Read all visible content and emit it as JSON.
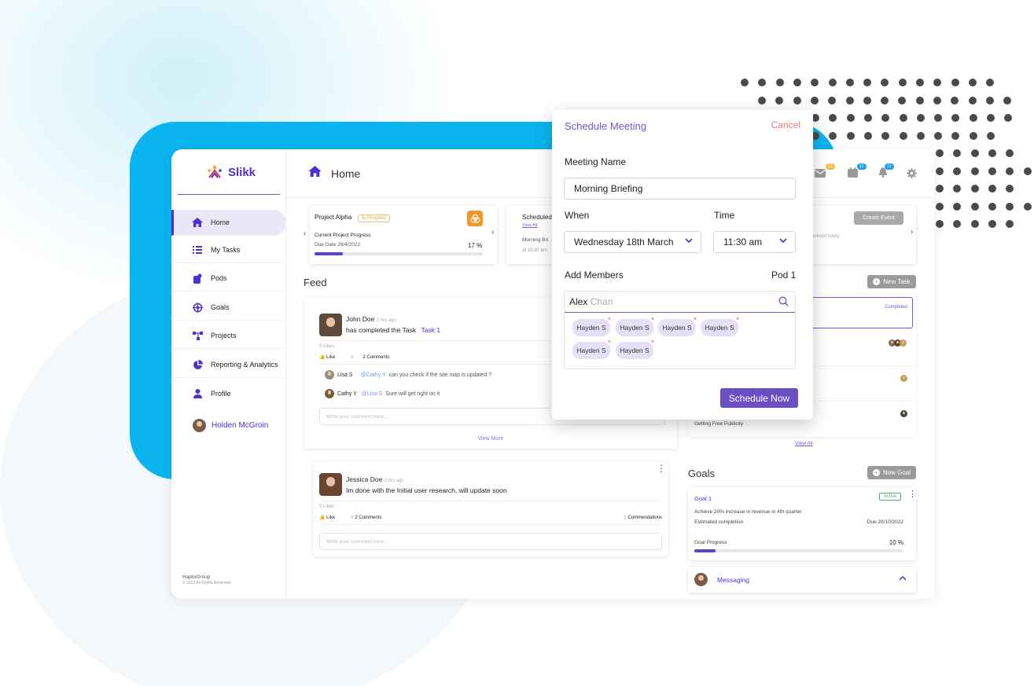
{
  "app": {
    "name": "Slikk",
    "page_title": "Home"
  },
  "sidebar": {
    "items": [
      {
        "label": "Home",
        "icon": "home-icon"
      },
      {
        "label": "My Tasks",
        "icon": "list-icon"
      },
      {
        "label": "Pods",
        "icon": "pods-icon"
      },
      {
        "label": "Goals",
        "icon": "target-icon"
      },
      {
        "label": "Projects",
        "icon": "projects-icon"
      },
      {
        "label": "Reporting & Analytics",
        "icon": "pie-chart-icon"
      },
      {
        "label": "Profile",
        "icon": "user-icon"
      }
    ],
    "user": "Holden McGroin",
    "footer_company": "HaptoGroup",
    "footer_rights": "2022 All Rights Reserved"
  },
  "header_icons": {
    "mail_count": "12",
    "calendar_count": "12",
    "bell_count": "12"
  },
  "project_card": {
    "name": "Project Alpha",
    "status": "In Progress",
    "progress_label": "Current Project Progress",
    "due": "Due Date 26/4/2022",
    "percent_text": "17 %",
    "progress": 0.17
  },
  "scheduled_card": {
    "title": "Scheduled",
    "link": "View All",
    "item": "Morning Bri",
    "time": "at 10:30 am"
  },
  "events_card": {
    "button": "Create Event",
    "note": "scheduled today"
  },
  "feed": {
    "title": "Feed",
    "post1": {
      "author": "John Doe",
      "time": "2 hrs ago",
      "text": "has completed the Task",
      "task": "Task 1",
      "likes": "5 Likes",
      "like_label": "Like",
      "comments": "2 Comments",
      "comment1_author": "Lisa S",
      "comment1_mention": "@Cathy Y",
      "comment1_text": "can you check if the site map is updated ?",
      "comment2_author": "Cathy Y",
      "comment2_mention": "@Lisa S",
      "comment2_text": "Sure will get right on it",
      "comment_placeholder": "Write your comment here...",
      "view_more": "View More"
    },
    "post2": {
      "author": "Jessica Doe",
      "time": "2 hrs ago",
      "text": "Im done with the Initial user research, will update soon",
      "likes": "5 Likes",
      "like_label": "Like",
      "comments": "2 Comments",
      "commendations": "Commendations",
      "comment_placeholder": "Write your comment here..."
    }
  },
  "tasks": {
    "new_task": "New Task",
    "completed": "Completed",
    "last_item": "Getting Free Publicity",
    "view_all": "View All"
  },
  "goals": {
    "title": "Goals",
    "new_goal": "New Goal",
    "goal_name": "Goal 1",
    "status": "Active",
    "description": "Achieve 20% increase in revenue in 4th quarter",
    "estimate_label": "Estimated completion",
    "due": "Due 28/10/2022",
    "progress_label": "Goal Progress",
    "percent_text": "10 %",
    "progress": 0.1
  },
  "messaging": {
    "label": "Messaging"
  },
  "modal": {
    "title": "Schedule Meeting",
    "cancel": "Cancel",
    "meeting_name_label": "Meeting Name",
    "meeting_name_value": "Morning Briefing",
    "when_label": "When",
    "when_value": "Wednesday 18th March",
    "time_label": "Time",
    "time_value": "11:30 am",
    "members_label": "Add Members",
    "pod": "Pod 1",
    "search_typed": "Alex",
    "search_suggest": "Chan",
    "members": [
      "Hayden S",
      "Hayden S",
      "Hayden S",
      "Hayden S",
      "Hayden S",
      "Hayden S"
    ],
    "submit": "Schedule Now"
  },
  "colors": {
    "accent": "#4b32d4",
    "brand_blue": "#0ab4ef",
    "cancel": "#f07a7a",
    "button": "#6a4fc2"
  }
}
